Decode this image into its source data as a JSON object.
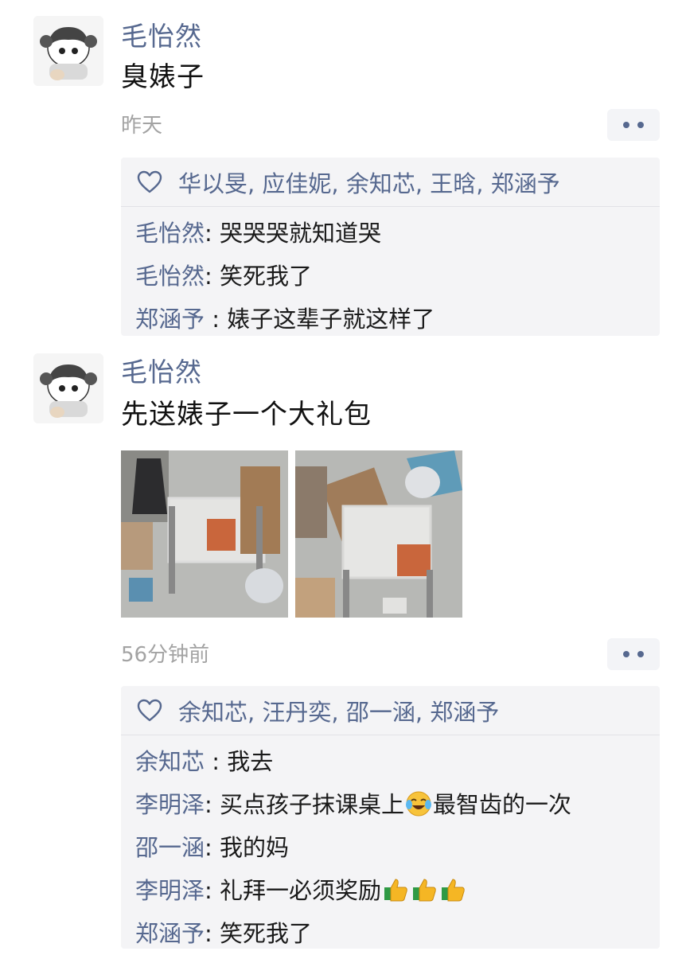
{
  "post1": {
    "author": "毛怡然",
    "content": "臭婊子",
    "time": "昨天",
    "likes": "华以旻, 应佳妮, 余知芯, 王晗, 郑涵予",
    "comments": [
      {
        "name": "毛怡然",
        "sep": ": ",
        "text": "哭哭哭就知道哭"
      },
      {
        "name": "毛怡然",
        "sep": ": ",
        "text": "笑死我了"
      },
      {
        "name": "郑涵予",
        "sep": " : ",
        "text": "婊子这辈子就这样了"
      }
    ]
  },
  "post2": {
    "author": "毛怡然",
    "content": "先送婊子一个大礼包",
    "time": "56分钟前",
    "likes": "余知芯, 汪丹奕, 邵一涵, 郑涵予",
    "comments": [
      {
        "name": "余知芯",
        "sep": " : ",
        "text": "我去"
      },
      {
        "name": "李明泽",
        "sep": ": ",
        "text_before": "买点孩子抹课桌上",
        "emoji": "crying-laughing-emoji",
        "text_after": "最智齿的一次"
      },
      {
        "name": "邵一涵",
        "sep": ": ",
        "text": "我的妈"
      },
      {
        "name": "李明泽",
        "sep": ": ",
        "text": "礼拜一必须奖励",
        "emoji": "thumbs-up-emoji",
        "emoji_count": 3
      },
      {
        "name": "郑涵予",
        "sep": ": ",
        "text": "笑死我了"
      }
    ]
  },
  "colors": {
    "name_blue": "#56688f",
    "time_gray": "#a3a3a3",
    "box_bg": "#f4f4f6"
  },
  "icons": {
    "like": "heart-outline-icon",
    "more": "two-dot-more-icon"
  }
}
